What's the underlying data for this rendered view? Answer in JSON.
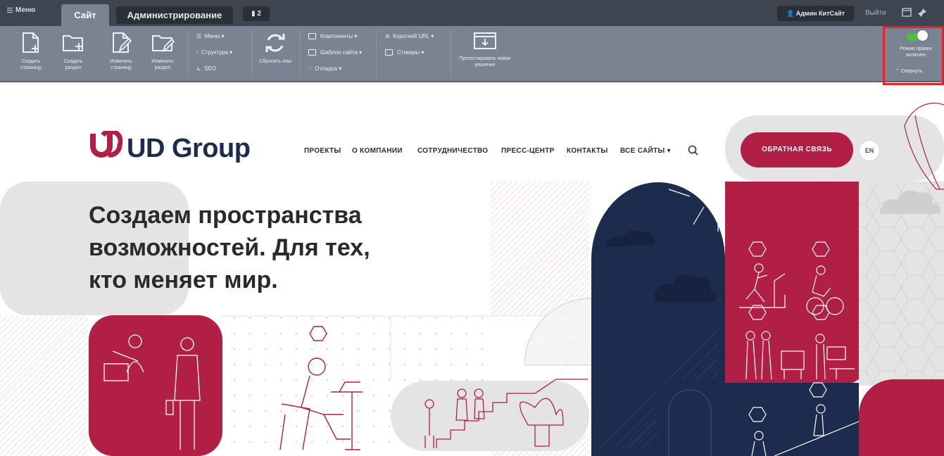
{
  "admin_bar": {
    "menu_label": "Меню",
    "tabs": [
      {
        "label": "Сайт"
      },
      {
        "label": "Администрирование"
      }
    ],
    "notifications_count": "2",
    "user_label": "Админ КитСайт",
    "logout_label": "Выйти"
  },
  "toolbar": {
    "create_page": "Создать страницу",
    "create_section": "Создать раздел",
    "edit_page": "Изменить страницу",
    "edit_section": "Изменить раздел",
    "menu": "Меню",
    "structure": "Структура",
    "seo": "SEO",
    "reset_cache": "Сбросить кеш",
    "components": "Компоненты",
    "site_template": "Шаблон сайта",
    "debug": "Отладка",
    "short_url": "Короткий URL",
    "stickers": "Стикеры",
    "test_solution": "Протестировать новое решение",
    "edit_mode": "Режим правки включен",
    "collapse": "Свернуть"
  },
  "site": {
    "logo_text": "UD Group",
    "nav": [
      "ПРОЕКТЫ",
      "О КОМПАНИИ",
      "СОТРУДНИЧЕСТВО",
      "ПРЕСС-ЦЕНТР",
      "КОНТАКТЫ",
      "ВСЕ САЙТЫ"
    ],
    "cta_label": "ОБРАТНАЯ СВЯЗЬ",
    "lang_label": "EN",
    "hero_lines": [
      "Создаем пространства",
      "возможностей. Для тех,",
      "кто меняет мир."
    ]
  },
  "colors": {
    "brand_red": "#b11f45",
    "brand_navy": "#1d2b4f",
    "admin_dark": "#3e4550",
    "admin_panel": "#7a8391",
    "toggle_on": "#4fbf3a",
    "highlight": "#e4232b"
  }
}
